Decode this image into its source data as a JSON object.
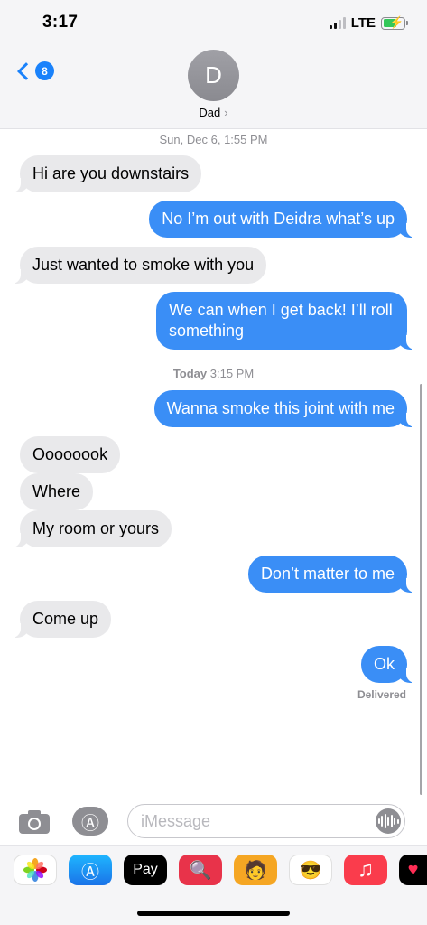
{
  "status": {
    "time": "3:17",
    "network": "LTE"
  },
  "header": {
    "back_count": "8",
    "avatar_initial": "D",
    "contact_name": "Dad",
    "contact_chevron": "›"
  },
  "timestamps": [
    {
      "day": "Sun, Dec 6,",
      "time": "1:55 PM"
    },
    {
      "day": "Today",
      "time": "3:15 PM"
    }
  ],
  "messages": [
    {
      "direction": "in",
      "text": "Hi are you downstairs"
    },
    {
      "direction": "out",
      "text": "No I’m out with Deidra what’s up"
    },
    {
      "direction": "in",
      "text": "Just wanted to smoke with you"
    },
    {
      "direction": "out",
      "text": "We can when I get back! I’ll roll something"
    },
    {
      "direction": "out",
      "text": "Wanna smoke this joint with me"
    },
    {
      "direction": "in",
      "text": "Oooooook"
    },
    {
      "direction": "in",
      "text": "Where"
    },
    {
      "direction": "in",
      "text": "My room or yours"
    },
    {
      "direction": "out",
      "text": "Don’t matter to me"
    },
    {
      "direction": "in",
      "text": "Come up"
    },
    {
      "direction": "out",
      "text": "Ok"
    }
  ],
  "delivered_label": "Delivered",
  "composer": {
    "placeholder": "iMessage",
    "camera_icon": "camera-icon",
    "appstore_icon": "app-store-icon",
    "audio_icon": "audio-waveform-icon"
  },
  "app_strip": {
    "apple_pay_label": "Pay",
    "apps": [
      "photos-icon",
      "app-store-icon",
      "apple-pay-icon",
      "web-images-icon",
      "memoji-icon",
      "animoji-icon",
      "music-icon",
      "heart-app-icon"
    ]
  },
  "colors": {
    "accent": "#1a82fb",
    "outgoing_bubble": "#3a8ef6",
    "incoming_bubble": "#e9e9eb"
  }
}
